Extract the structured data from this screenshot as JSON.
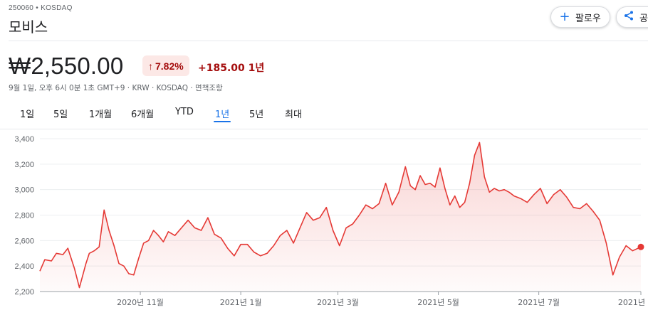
{
  "header": {
    "ticker": "250060 • KOSDAQ",
    "name": "모비스",
    "follow_label": "팔로우",
    "share_label": "공유"
  },
  "quote": {
    "price": "₩2,550.00",
    "change_pct": "7.82%",
    "change_abs": "+185.00 1년",
    "meta": "9월 1일, 오후 6시 0분 1초 GMT+9 · KRW · KOSDAQ · 면책조항",
    "accent_color": "#a50e0e",
    "line_color": "#e53935"
  },
  "ranges": [
    "1일",
    "5일",
    "1개월",
    "6개월",
    "YTD",
    "1년",
    "5년",
    "최대"
  ],
  "active_range": "1년",
  "chart_data": {
    "type": "area",
    "y_ticks": [
      "3,400",
      "3,200",
      "3,000",
      "2,800",
      "2,600",
      "2,400",
      "2,200"
    ],
    "y_tick_values": [
      3400,
      3200,
      3000,
      2800,
      2600,
      2400,
      2200
    ],
    "x_ticks": [
      "2020년 11월",
      "2021년 1월",
      "2021년 3월",
      "2021년 5월",
      "2021년 7월",
      "2021년"
    ],
    "x_tick_values": [
      "2020-11-01",
      "2021-01-01",
      "2021-03-01",
      "2021-05-01",
      "2021-07-01",
      "2021-09-01"
    ],
    "ylim": [
      2200,
      3400
    ],
    "xlim": [
      "2020-09-01",
      "2021-09-01"
    ],
    "grid": true,
    "series": [
      {
        "x": [
          "2020-09-01",
          "2020-09-04",
          "2020-09-08",
          "2020-09-11",
          "2020-09-15",
          "2020-09-18",
          "2020-09-22",
          "2020-09-25",
          "2020-09-29",
          "2020-10-01",
          "2020-10-04",
          "2020-10-07",
          "2020-10-10",
          "2020-10-13",
          "2020-10-16",
          "2020-10-19",
          "2020-10-22",
          "2020-10-25",
          "2020-10-28",
          "2020-10-31",
          "2020-11-03",
          "2020-11-06",
          "2020-11-09",
          "2020-11-12",
          "2020-11-15",
          "2020-11-18",
          "2020-11-22",
          "2020-11-26",
          "2020-11-30",
          "2020-12-04",
          "2020-12-08",
          "2020-12-12",
          "2020-12-16",
          "2020-12-20",
          "2020-12-24",
          "2020-12-28",
          "2021-01-01",
          "2021-01-05",
          "2021-01-09",
          "2021-01-13",
          "2021-01-17",
          "2021-01-21",
          "2021-01-25",
          "2021-01-29",
          "2021-02-02",
          "2021-02-06",
          "2021-02-10",
          "2021-02-14",
          "2021-02-18",
          "2021-02-22",
          "2021-02-26",
          "2021-03-02",
          "2021-03-06",
          "2021-03-10",
          "2021-03-14",
          "2021-03-18",
          "2021-03-22",
          "2021-03-26",
          "2021-03-30",
          "2021-04-03",
          "2021-04-07",
          "2021-04-11",
          "2021-04-14",
          "2021-04-17",
          "2021-04-20",
          "2021-04-23",
          "2021-04-26",
          "2021-04-29",
          "2021-05-02",
          "2021-05-05",
          "2021-05-08",
          "2021-05-11",
          "2021-05-14",
          "2021-05-17",
          "2021-05-20",
          "2021-05-23",
          "2021-05-26",
          "2021-05-29",
          "2021-06-01",
          "2021-06-04",
          "2021-06-07",
          "2021-06-10",
          "2021-06-13",
          "2021-06-16",
          "2021-06-20",
          "2021-06-24",
          "2021-06-28",
          "2021-07-02",
          "2021-07-06",
          "2021-07-10",
          "2021-07-14",
          "2021-07-18",
          "2021-07-22",
          "2021-07-26",
          "2021-07-30",
          "2021-08-03",
          "2021-08-07",
          "2021-08-11",
          "2021-08-15",
          "2021-08-19",
          "2021-08-23",
          "2021-08-27",
          "2021-09-01"
        ],
        "y": [
          2360,
          2450,
          2440,
          2500,
          2490,
          2540,
          2380,
          2230,
          2420,
          2500,
          2520,
          2550,
          2840,
          2680,
          2560,
          2420,
          2400,
          2340,
          2330,
          2460,
          2580,
          2600,
          2680,
          2640,
          2590,
          2670,
          2640,
          2700,
          2760,
          2700,
          2680,
          2780,
          2650,
          2620,
          2540,
          2480,
          2570,
          2570,
          2510,
          2480,
          2500,
          2560,
          2640,
          2680,
          2580,
          2700,
          2820,
          2760,
          2780,
          2860,
          2680,
          2560,
          2700,
          2730,
          2800,
          2880,
          2850,
          2890,
          3050,
          2880,
          2980,
          3180,
          3030,
          3000,
          3110,
          3040,
          3050,
          3020,
          3170,
          3010,
          2880,
          2950,
          2860,
          2900,
          3050,
          3270,
          3370,
          3100,
          2980,
          3010,
          2990,
          3000,
          2980,
          2950,
          2930,
          2900,
          2960,
          3010,
          2890,
          2960,
          3000,
          2940,
          2860,
          2850,
          2890,
          2830,
          2760,
          2580,
          2330,
          2470,
          2560,
          2520,
          2550
        ]
      }
    ]
  }
}
